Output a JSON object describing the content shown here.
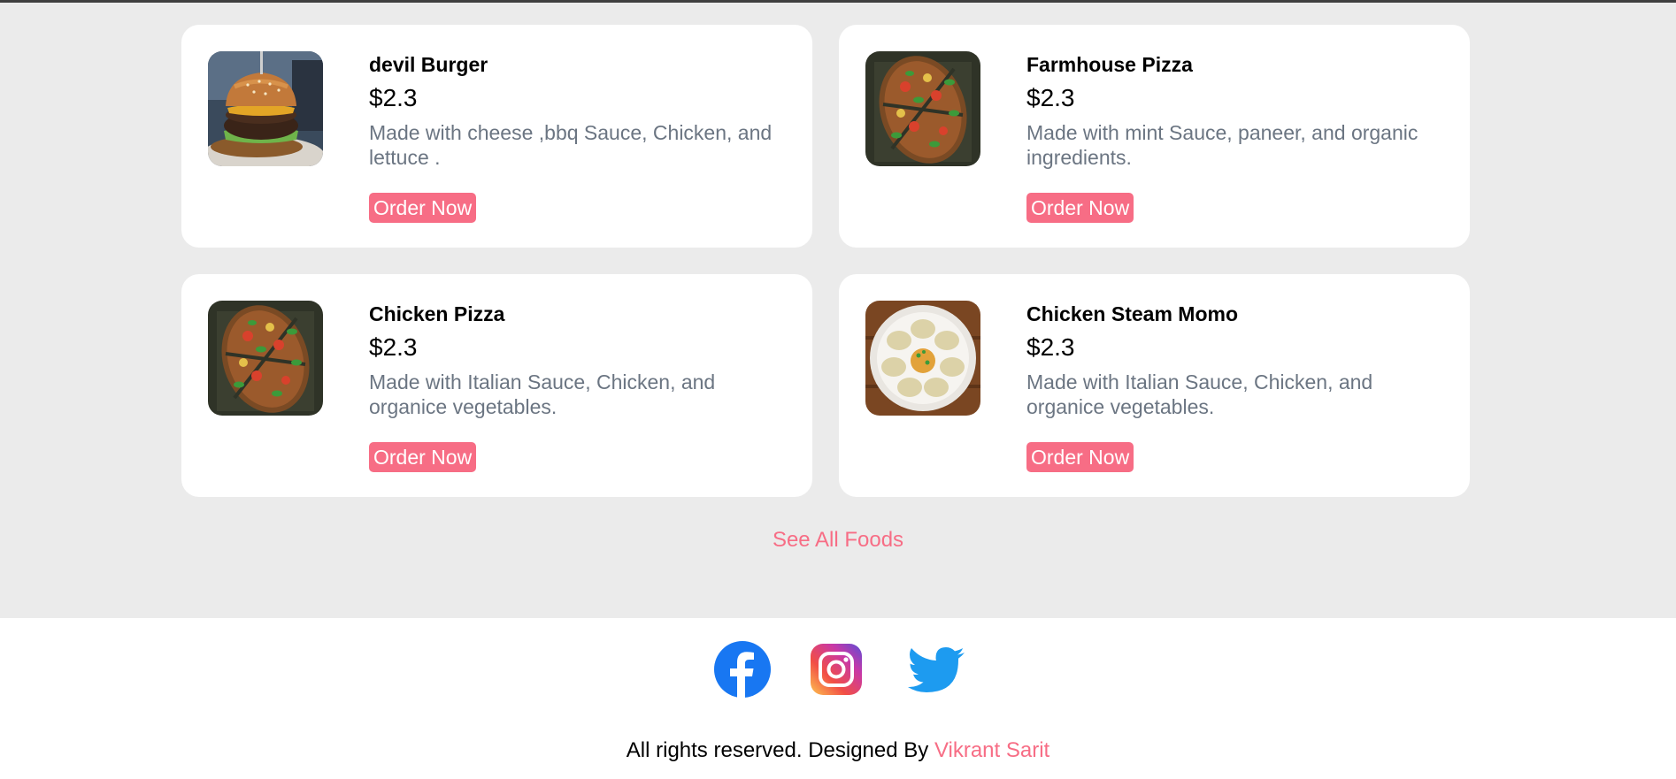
{
  "colors": {
    "accent": "#f76d85",
    "section_background": "#ebebeb",
    "card_background": "#ffffff",
    "description_text": "#6b7582"
  },
  "foods": [
    {
      "name": "devil Burger",
      "price": "$2.3",
      "description": "Made with cheese ,bbq Sauce, Chicken, and lettuce .",
      "button_label": "Order Now",
      "image": "burger-image"
    },
    {
      "name": "Farmhouse Pizza",
      "price": "$2.3",
      "description": "Made with mint Sauce, paneer, and organic ingredients.",
      "button_label": "Order Now",
      "image": "pizza-image"
    },
    {
      "name": "Chicken Pizza",
      "price": "$2.3",
      "description": "Made with Italian Sauce, Chicken, and organice vegetables.",
      "button_label": "Order Now",
      "image": "pizza-image"
    },
    {
      "name": "Chicken Steam Momo",
      "price": "$2.3",
      "description": "Made with Italian Sauce, Chicken, and organice vegetables.",
      "button_label": "Order Now",
      "image": "momo-image"
    }
  ],
  "see_all_label": "See All Foods",
  "footer": {
    "social": [
      {
        "name": "facebook",
        "icon": "facebook-icon"
      },
      {
        "name": "instagram",
        "icon": "instagram-icon"
      },
      {
        "name": "twitter",
        "icon": "twitter-icon"
      }
    ],
    "rights_text": "All rights reserved. Designed By ",
    "designer_name": "Vikrant Sarit"
  }
}
